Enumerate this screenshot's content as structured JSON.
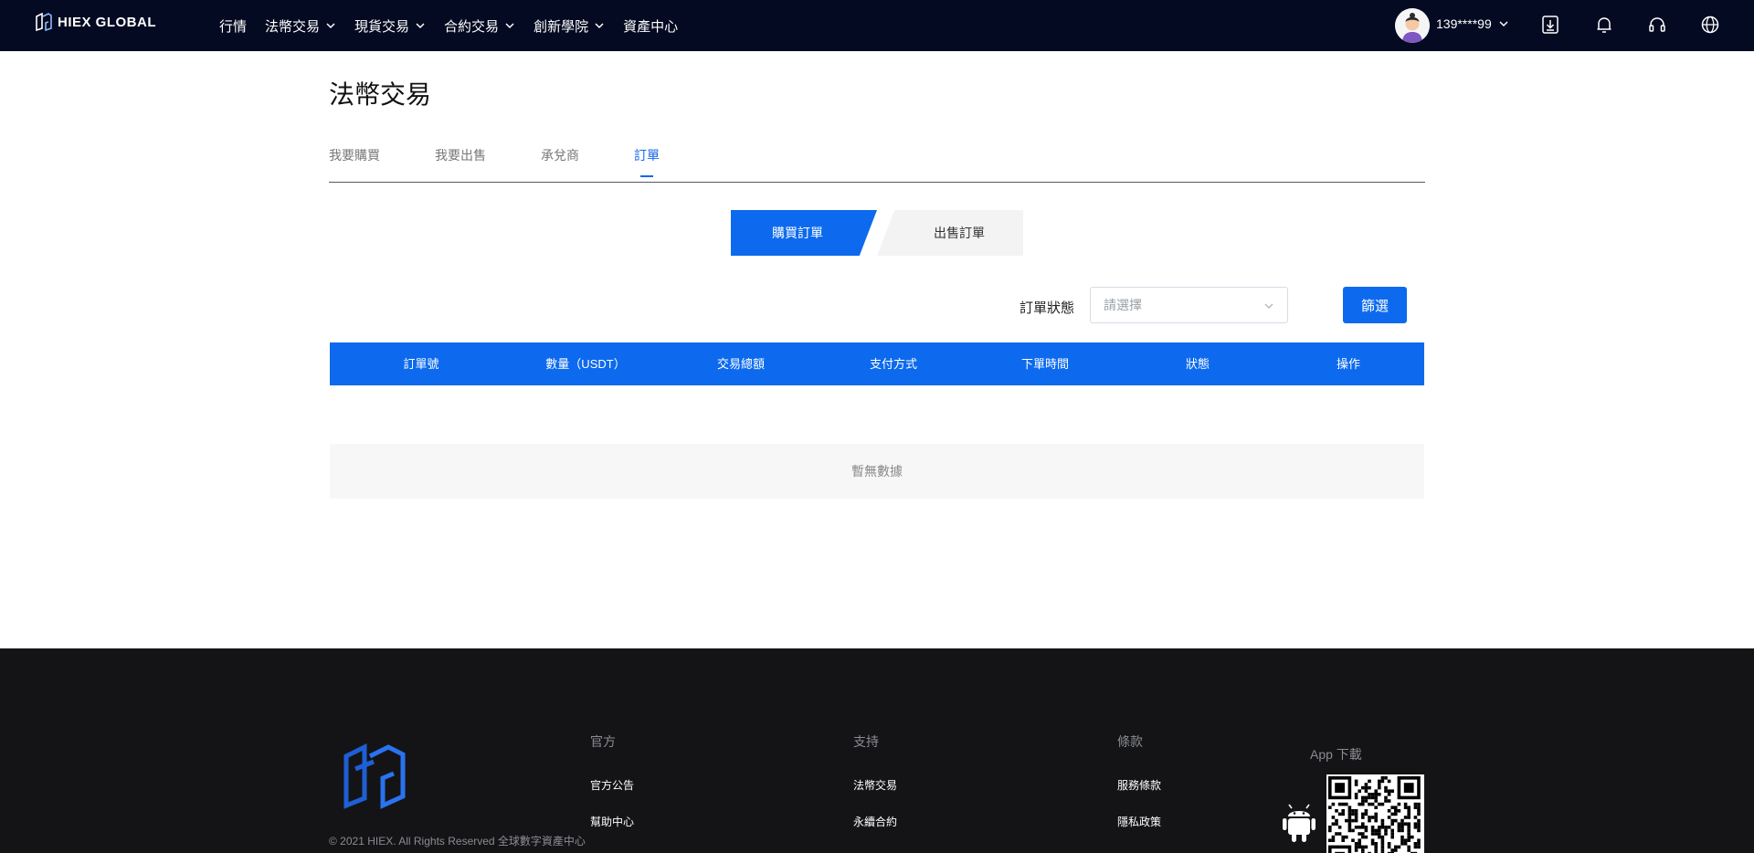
{
  "header": {
    "logo_text": "HIEX GLOBAL",
    "nav": [
      {
        "label": "行情",
        "dropdown": false
      },
      {
        "label": "法幣交易",
        "dropdown": true
      },
      {
        "label": "現貨交易",
        "dropdown": true
      },
      {
        "label": "合約交易",
        "dropdown": true
      },
      {
        "label": "創新學院",
        "dropdown": true
      },
      {
        "label": "資產中心",
        "dropdown": false
      }
    ],
    "user_name": "139****99",
    "icons": [
      "download-icon",
      "bell-icon",
      "headset-icon",
      "globe-icon"
    ]
  },
  "page": {
    "title": "法幣交易",
    "tabs": [
      "我要購買",
      "我要出售",
      "承兌商",
      "訂單"
    ],
    "active_tab": "訂單"
  },
  "order_switch": {
    "buy": "購買訂單",
    "sell": "出售訂單",
    "active": "購買訂單"
  },
  "filter": {
    "label": "訂單狀態",
    "placeholder": "請選擇",
    "button": "篩選"
  },
  "table": {
    "columns": [
      "訂單號",
      "數量（USDT）",
      "交易總額",
      "支付方式",
      "下單時間",
      "狀態",
      "操作"
    ],
    "rows": [],
    "empty_text": "暫無數據"
  },
  "footer": {
    "columns": [
      {
        "title": "官方",
        "links": [
          "官方公告",
          "幫助中心"
        ]
      },
      {
        "title": "支持",
        "links": [
          "法幣交易",
          "永續合約"
        ]
      },
      {
        "title": "條款",
        "links": [
          "服務條款",
          "隱私政策"
        ]
      }
    ],
    "app_title": "App 下載",
    "copyright": "© 2021 HIEX. All Rights Reserved 全球數字資產中心"
  },
  "colors": {
    "header_bg": "#030a21",
    "accent": "#0d6aee",
    "footer_bg": "#141416"
  }
}
